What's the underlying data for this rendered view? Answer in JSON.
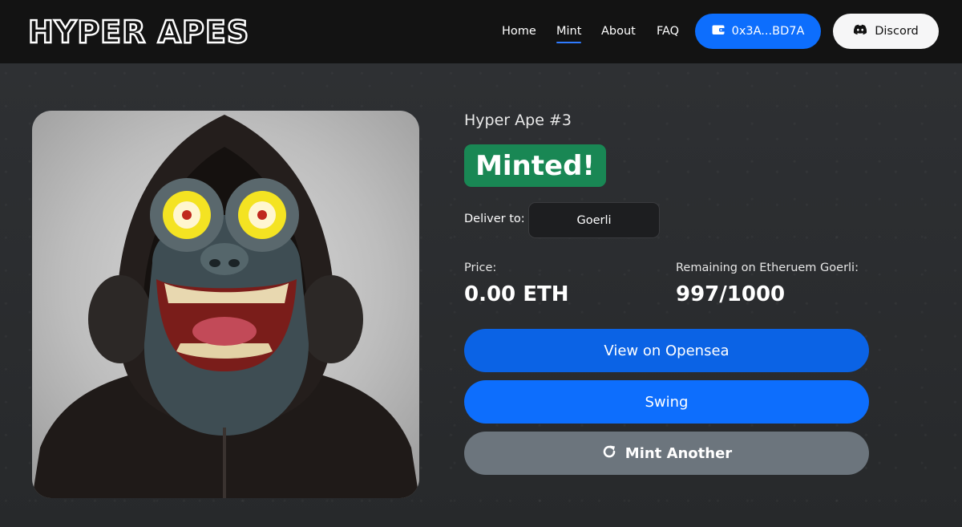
{
  "header": {
    "logo": "HYPER APES",
    "nav": [
      {
        "label": "Home"
      },
      {
        "label": "Mint"
      },
      {
        "label": "About"
      },
      {
        "label": "FAQ"
      }
    ],
    "wallet_label": "0x3A...BD7A",
    "discord_label": "Discord"
  },
  "nft": {
    "name": "Hyper Ape #3",
    "status": "Minted!",
    "deliver_label": "Deliver to:",
    "network": "Goerli",
    "price_label": "Price:",
    "price_value": "0.00 ETH",
    "remaining_label": "Remaining on Etheruem Goerli:",
    "remaining_value": "997/1000"
  },
  "actions": {
    "opensea_label": "View on Opensea",
    "swing_label": "Swing",
    "mint_another_label": "Mint Another"
  },
  "icons": {
    "wallet": "wallet-icon",
    "discord": "discord-icon",
    "refresh": "refresh-icon"
  },
  "colors": {
    "primary": "#0d6efd",
    "success": "#198754",
    "secondary": "#6c757d",
    "navbar": "#131313",
    "background": "#2b2d30"
  }
}
